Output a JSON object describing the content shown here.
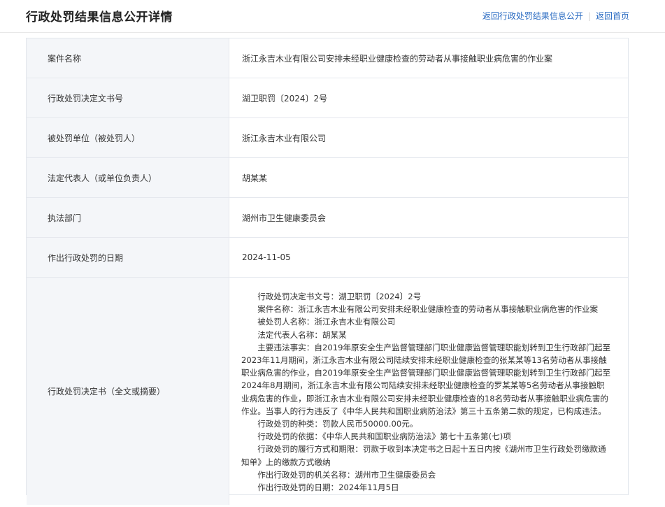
{
  "header": {
    "title": "行政处罚结果信息公开详情",
    "link_back_list": "返回行政处罚结果信息公开",
    "link_home": "返回首页"
  },
  "rows": [
    {
      "label": "案件名称",
      "value": "浙江永吉木业有限公司安排未经职业健康检查的劳动者从事接触职业病危害的作业案"
    },
    {
      "label": "行政处罚决定文书号",
      "value": "湖卫职罚〔2024〕2号"
    },
    {
      "label": "被处罚单位（被处罚人）",
      "value": "浙江永吉木业有限公司"
    },
    {
      "label": "法定代表人（或单位负责人）",
      "value": "胡某某"
    },
    {
      "label": "执法部门",
      "value": "湖州市卫生健康委员会"
    },
    {
      "label": "作出行政处罚的日期",
      "value": "2024-11-05"
    }
  ],
  "full_text": {
    "label": "行政处罚决定书（全文或摘要）",
    "paragraphs": [
      "行政处罚决定书文号：湖卫职罚〔2024〕2号",
      "案件名称：浙江永吉木业有限公司安排未经职业健康检查的劳动者从事接触职业病危害的作业案",
      "被处罚人名称：浙江永吉木业有限公司",
      "法定代表人名称：胡某某",
      "主要违法事实：自2019年原安全生产监督管理部门职业健康监督管理职能划转到卫生行政部门起至2023年11月期间，浙江永吉木业有限公司陆续安排未经职业健康检查的张某某等13名劳动者从事接触职业病危害的作业，自2019年原安全生产监督管理部门职业健康监督管理职能划转到卫生行政部门起至2024年8月期间，浙江永吉木业有限公司陆续安排未经职业健康检查的罗某某等5名劳动者从事接触职业病危害的作业，即浙江永吉木业有限公司安排未经职业健康检查的18名劳动者从事接触职业病危害的作业。当事人的行为违反了《中华人民共和国职业病防治法》第三十五条第二款的规定，已构成违法。",
      "行政处罚的种类：罚款人民币50000.00元。",
      "行政处罚的依据：《中华人民共和国职业病防治法》第七十五条第(七)项",
      "行政处罚的履行方式和期限：罚款于收到本决定书之日起十五日内按《湖州市卫生行政处罚缴款通知单》上的缴款方式缴纳",
      "作出行政处罚的机关名称：湖州市卫生健康委员会",
      "作出行政处罚的日期：2024年11月5日"
    ]
  }
}
